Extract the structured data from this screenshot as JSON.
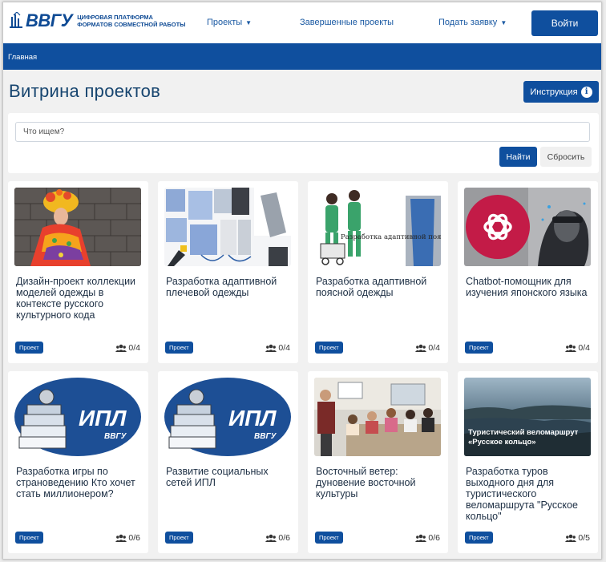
{
  "header": {
    "logo_text": "ВВГУ",
    "logo_subtitle_line1": "ЦИФРОВАЯ ПЛАТФОРМА",
    "logo_subtitle_line2": "ФОРМАТОВ СОВМЕСТНОЙ РАБОТЫ",
    "nav": [
      {
        "label": "Проекты",
        "dropdown": true
      },
      {
        "label": "Завершенные проекты",
        "dropdown": false
      },
      {
        "label": "Подать заявку",
        "dropdown": true
      }
    ],
    "login_label": "Войти"
  },
  "breadcrumb": {
    "home": "Главная"
  },
  "page": {
    "title": "Витрина проектов",
    "guide_label": "Инструкция"
  },
  "search": {
    "placeholder": "Что ищем?",
    "find_label": "Найти",
    "reset_label": "Сбросить"
  },
  "colors": {
    "brand": "#0f4f9e",
    "title": "#17456f"
  },
  "cards": [
    {
      "title": "Дизайн-проект коллекции моделей одежды в контексте русского культурного кода",
      "badge": "Проект",
      "members": "0/4",
      "image": "folk-costume-photo"
    },
    {
      "title": "Разработка адаптивной плечевой одежды",
      "badge": "Проект",
      "members": "0/4",
      "image": "clothing-collage"
    },
    {
      "title": "Разработка адаптивной поясной одежды",
      "badge": "Проект",
      "members": "0/4",
      "image": "adaptive-clothing-illustration",
      "image_text": "Разработка адаптивной поясной одежды"
    },
    {
      "title": "Chatbot-помощник для изучения японского языка",
      "badge": "Проект",
      "members": "0/4",
      "image": "openai-logo-face"
    },
    {
      "title": "Разработка игры по страноведению Кто хочет стать миллионером?",
      "badge": "Проект",
      "members": "0/6",
      "image": "ipl-books-logo",
      "image_text": "ИПЛ",
      "image_subtext": "ВВГУ"
    },
    {
      "title": "Развитие социальных сетей ИПЛ",
      "badge": "Проект",
      "members": "0/6",
      "image": "ipl-books-logo",
      "image_text": "ИПЛ",
      "image_subtext": "ВВГУ"
    },
    {
      "title": "Восточный ветер: дуновение восточной культуры",
      "badge": "Проект",
      "members": "0/6",
      "image": "classroom-photo"
    },
    {
      "title": "Разработка туров выходного дня для туристического веломаршрута \"Русское кольцо\"",
      "badge": "Проект",
      "members": "0/5",
      "image": "landscape-photo",
      "image_text": "Туристический веломаршрут «Русское кольцо»"
    }
  ]
}
